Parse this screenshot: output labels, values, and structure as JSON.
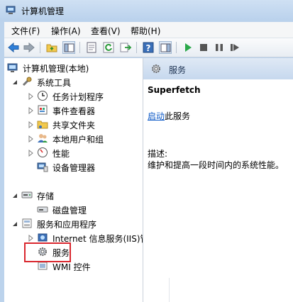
{
  "window": {
    "title": "计算机管理"
  },
  "menu": [
    "文件(F)",
    "操作(A)",
    "查看(V)",
    "帮助(H)"
  ],
  "toolbar": {
    "buttons": [
      "back-icon",
      "forward-icon",
      "up-folder-icon",
      "show-hide-tree-icon",
      "properties-icon",
      "refresh-icon",
      "export-icon",
      "help-icon",
      "show-hide-action-icon",
      "play-icon",
      "stop-icon",
      "pause-icon",
      "restart-icon"
    ]
  },
  "tree": {
    "root": "计算机管理(本地)",
    "system_tools": "系统工具",
    "task_scheduler": "任务计划程序",
    "event_viewer": "事件查看器",
    "shared_folders": "共享文件夹",
    "local_users_groups": "本地用户和组",
    "performance": "性能",
    "device_manager": "设备管理器",
    "storage": "存储",
    "disk_management": "磁盘管理",
    "services_apps": "服务和应用程序",
    "iis": "Internet 信息服务(IIS)管",
    "services": "服务",
    "wmi": "WMI 控件"
  },
  "detail": {
    "header": "服务",
    "service_name": "Superfetch",
    "start_link": "启动",
    "start_suffix": "此服务",
    "desc_label": "描述:",
    "desc_text": "维护和提高一段时间内的系统性能。"
  },
  "colors": {
    "highlight": "#d9272e",
    "link": "#0a57c6"
  }
}
